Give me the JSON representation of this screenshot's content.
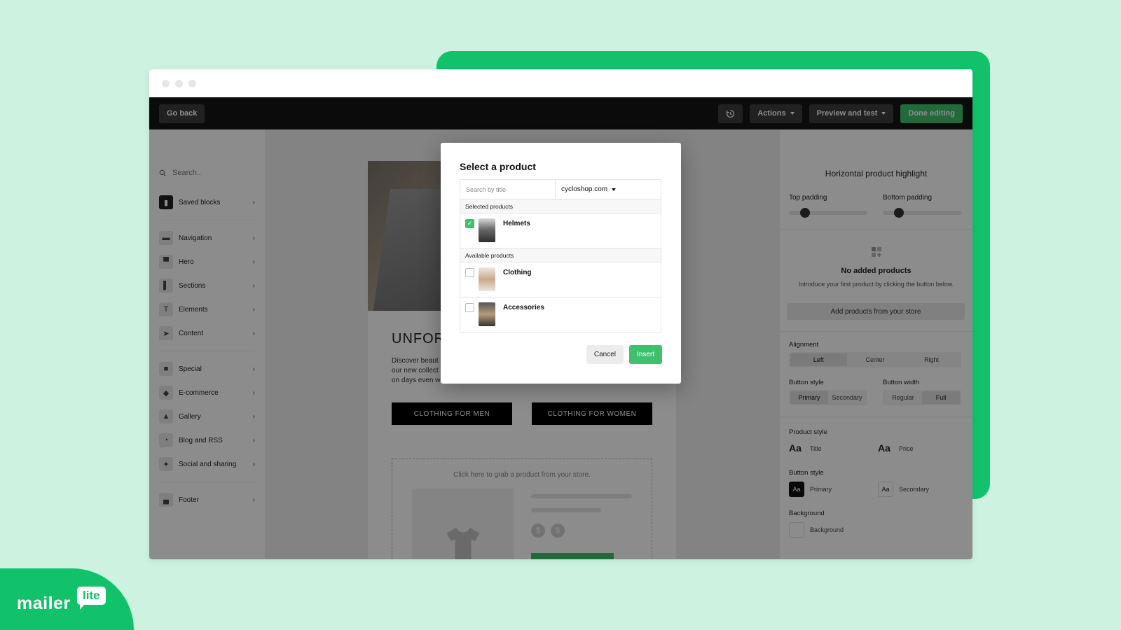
{
  "topbar": {
    "go_back": "Go back",
    "actions": "Actions",
    "preview": "Preview and test",
    "done": "Done editing"
  },
  "sidebar": {
    "search_placeholder": "Search..",
    "items": [
      {
        "label": "Saved blocks",
        "icon": "bookmark-icon"
      },
      {
        "label": "Navigation",
        "icon": "navigation-icon"
      },
      {
        "label": "Hero",
        "icon": "hero-icon"
      },
      {
        "label": "Sections",
        "icon": "sections-icon"
      },
      {
        "label": "Elements",
        "icon": "text-icon"
      },
      {
        "label": "Content",
        "icon": "cursor-icon"
      },
      {
        "label": "Special",
        "icon": "special-icon"
      },
      {
        "label": "E-commerce",
        "icon": "tag-icon"
      },
      {
        "label": "Gallery",
        "icon": "image-icon"
      },
      {
        "label": "Blog and RSS",
        "icon": "rss-icon"
      },
      {
        "label": "Social and sharing",
        "icon": "twitter-icon"
      },
      {
        "label": "Footer",
        "icon": "footer-icon"
      }
    ]
  },
  "canvas": {
    "headline": "UNFORC",
    "lead_lines": [
      "Discover beaut",
      "our new collect",
      "on days even w"
    ],
    "cta_men": "CLOTHING FOR MEN",
    "cta_women": "CLOTHING FOR WOMEN",
    "placeholder_label": "Click here to grab a product from your store."
  },
  "right_panel": {
    "title": "Horizontal product highlight",
    "top_padding": "Top padding",
    "bottom_padding": "Bottom padding",
    "no_products_title": "No added products",
    "no_products_desc": "Introduce your first product by clicking the button below.",
    "add_products": "Add products from your store",
    "alignment": "Alignment",
    "alignment_options": [
      "Left",
      "Center",
      "Right"
    ],
    "button_style": "Button style",
    "button_style_options": [
      "Primary",
      "Secondary"
    ],
    "button_width": "Button width",
    "button_width_options": [
      "Regular",
      "Full"
    ],
    "product_style": "Product style",
    "aa": "Aa",
    "title_label": "Title",
    "price_label": "Price",
    "button_style_2": "Button style",
    "primary_label": "Primary",
    "secondary_label": "Secondary",
    "background": "Background",
    "background_label": "Background"
  },
  "modal": {
    "title": "Select a product",
    "search_placeholder": "Search by title",
    "domain": "cycloshop.com",
    "selected_section": "Selected products",
    "available_section": "Available products",
    "selected": [
      {
        "name": "Helmets",
        "checked": true
      }
    ],
    "available": [
      {
        "name": "Clothing",
        "checked": false
      },
      {
        "name": "Accessories",
        "checked": false
      }
    ],
    "cancel": "Cancel",
    "insert": "Insert"
  },
  "brand": {
    "name": "mailer",
    "bubble": "lite"
  },
  "colors": {
    "brand_green": "#11c26b",
    "button_green": "#3fc06c",
    "background": "#cdf2e0"
  }
}
